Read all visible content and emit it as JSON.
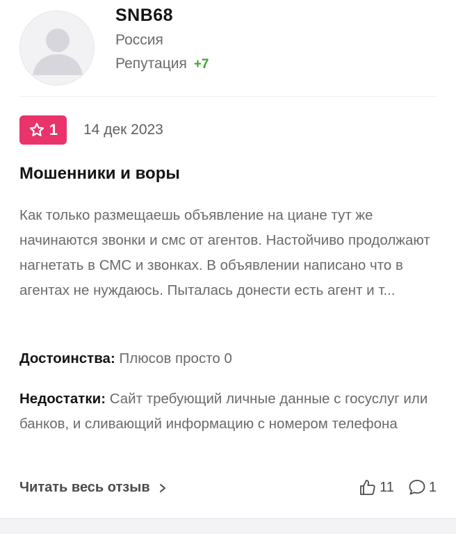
{
  "user": {
    "name": "SNB68",
    "country": "Россия",
    "reputation_label": "Репутация",
    "reputation_value": "+7",
    "avatar_icon": "user-silhouette-icon"
  },
  "review": {
    "rating": "1",
    "rating_icon": "star-icon",
    "rating_color": "#e8336b",
    "date": "14 дек 2023",
    "title": "Мошенники и воры",
    "text": "Как только размещаешь объявление на циане тут же начинаются звонки и смс от агентов. Настойчиво продолжают нагнетать в СМС и звонках. В объявлении написано что в агентах не нуждаюсь. Пыталась донести есть агент и т...",
    "pros_label": "Достоинства:",
    "pros_text": "Плюсов просто 0",
    "cons_label": "Недостатки:",
    "cons_text": "Сайт требующий личные данные с госуслуг или банков, и сливающий информацию с номером телефона"
  },
  "footer": {
    "read_more_label": "Читать весь отзыв",
    "likes_count": "11",
    "comments_count": "1",
    "like_icon": "thumbs-up-icon",
    "comment_icon": "comment-icon",
    "reputation_color": "#3fa535"
  }
}
